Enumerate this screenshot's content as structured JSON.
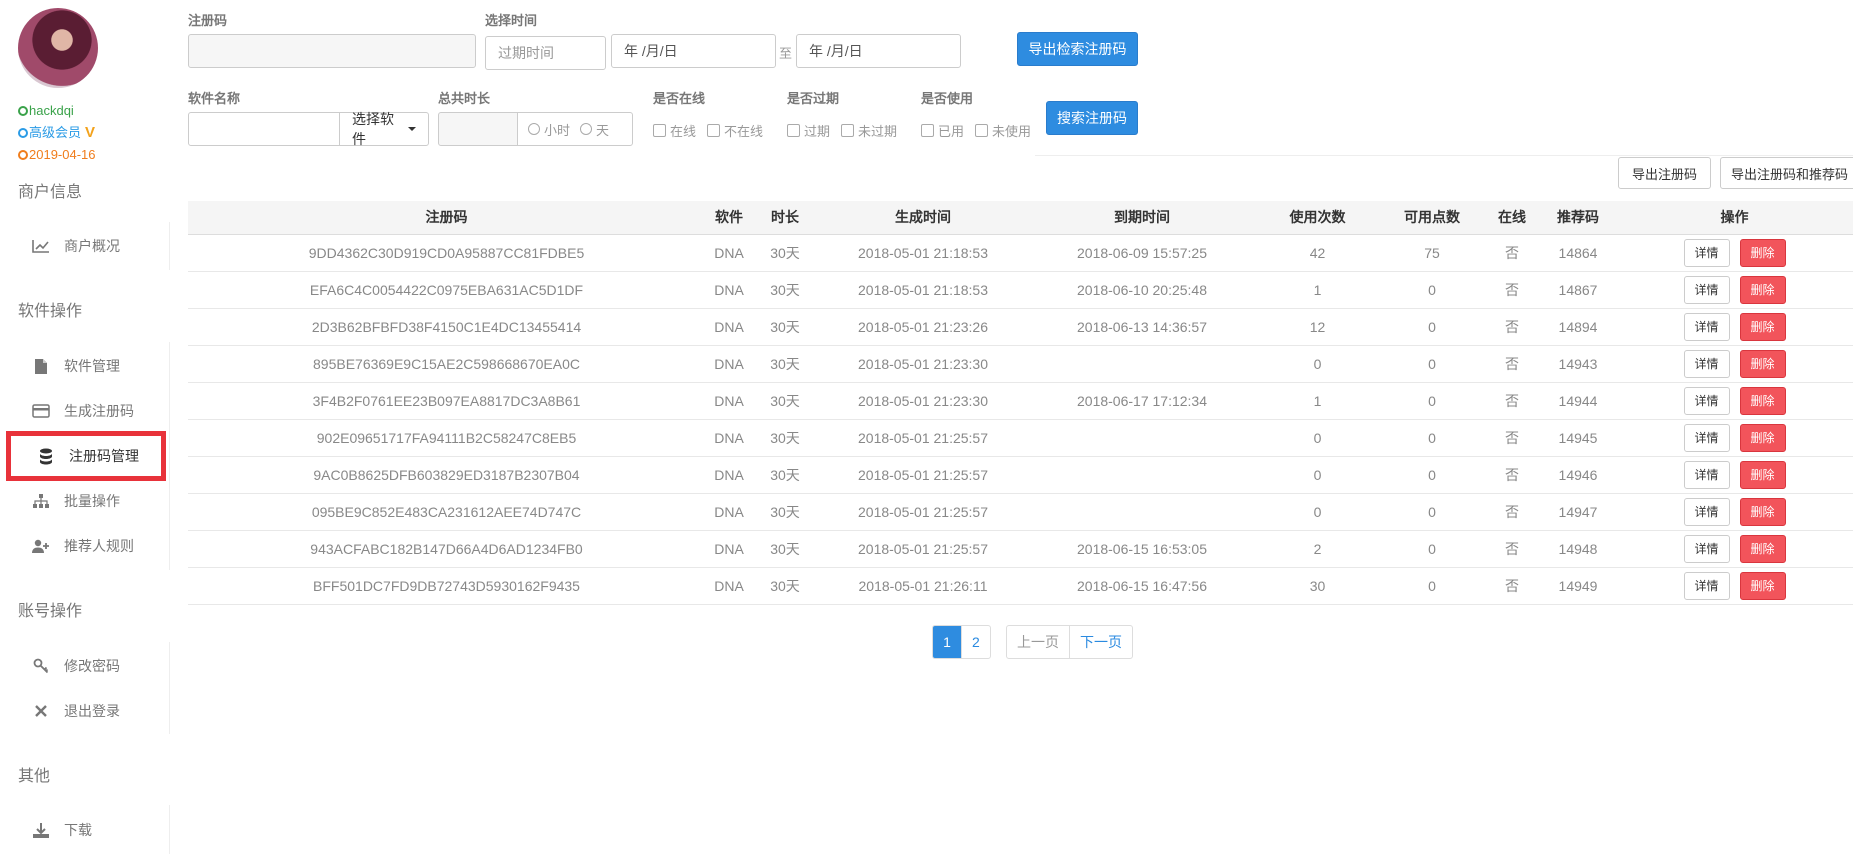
{
  "user": {
    "name": "hackdqi",
    "level": "高级会员",
    "vip_badge": "V",
    "date": "2019-04-16"
  },
  "sidebar": {
    "sections": [
      {
        "title": "商户信息",
        "items": [
          {
            "label": "商户概况",
            "icon": "chart-line-icon"
          }
        ]
      },
      {
        "title": "软件操作",
        "items": [
          {
            "label": "软件管理",
            "icon": "file-icon"
          },
          {
            "label": "生成注册码",
            "icon": "credit-card-icon"
          },
          {
            "label": "注册码管理",
            "icon": "database-icon",
            "active": true
          },
          {
            "label": "批量操作",
            "icon": "sitemap-icon"
          },
          {
            "label": "推荐人规则",
            "icon": "user-plus-icon"
          }
        ]
      },
      {
        "title": "账号操作",
        "items": [
          {
            "label": "修改密码",
            "icon": "key-icon"
          },
          {
            "label": "退出登录",
            "icon": "close-icon"
          }
        ]
      },
      {
        "title": "其他",
        "items": [
          {
            "label": "下载",
            "icon": "download-icon"
          }
        ]
      }
    ]
  },
  "filters": {
    "code_label": "注册码",
    "code_value": "",
    "time_label": "选择时间",
    "expire_placeholder": "过期时间",
    "date_from": "年 /月/日",
    "to_label": "至",
    "date_to": "年 /月/日",
    "export_search_label": "导出检索注册码",
    "software_label": "软件名称",
    "software_value": "",
    "select_software_label": "选择软件",
    "duration_label": "总共时长",
    "duration_value": "",
    "unit_hour": "小时",
    "unit_day": "天",
    "online_label": "是否在线",
    "online_yes": "在线",
    "online_no": "不在线",
    "expired_label": "是否过期",
    "expired_yes": "过期",
    "expired_no": "未过期",
    "used_label": "是否使用",
    "used_yes": "已用",
    "used_no": "未使用",
    "search_label": "搜索注册码"
  },
  "toolbar": {
    "export_label": "导出注册码",
    "export_ref_label": "导出注册码和推荐码"
  },
  "table": {
    "columns": [
      "注册码",
      "软件",
      "时长",
      "生成时间",
      "到期时间",
      "使用次数",
      "可用点数",
      "在线",
      "推荐码",
      "操作"
    ],
    "detail_label": "详情",
    "delete_label": "删除",
    "rows": [
      [
        "9DD4362C30D919CD0A95887CC81FDBE5",
        "DNA",
        "30天",
        "2018-05-01 21:18:53",
        "2018-06-09 15:57:25",
        "42",
        "75",
        "否",
        "14864"
      ],
      [
        "EFA6C4C0054422C0975EBA631AC5D1DF",
        "DNA",
        "30天",
        "2018-05-01 21:18:53",
        "2018-06-10 20:25:48",
        "1",
        "0",
        "否",
        "14867"
      ],
      [
        "2D3B62BFBFD38F4150C1E4DC13455414",
        "DNA",
        "30天",
        "2018-05-01 21:23:26",
        "2018-06-13 14:36:57",
        "12",
        "0",
        "否",
        "14894"
      ],
      [
        "895BE76369E9C15AE2C598668670EA0C",
        "DNA",
        "30天",
        "2018-05-01 21:23:30",
        "",
        "0",
        "0",
        "否",
        "14943"
      ],
      [
        "3F4B2F0761EE23B097EA8817DC3A8B61",
        "DNA",
        "30天",
        "2018-05-01 21:23:30",
        "2018-06-17 17:12:34",
        "1",
        "0",
        "否",
        "14944"
      ],
      [
        "902E09651717FA94111B2C58247C8EB5",
        "DNA",
        "30天",
        "2018-05-01 21:25:57",
        "",
        "0",
        "0",
        "否",
        "14945"
      ],
      [
        "9AC0B8625DFB603829ED3187B2307B04",
        "DNA",
        "30天",
        "2018-05-01 21:25:57",
        "",
        "0",
        "0",
        "否",
        "14946"
      ],
      [
        "095BE9C852E483CA231612AEE74D747C",
        "DNA",
        "30天",
        "2018-05-01 21:25:57",
        "",
        "0",
        "0",
        "否",
        "14947"
      ],
      [
        "943ACFABC182B147D66A4D6AD1234FB0",
        "DNA",
        "30天",
        "2018-05-01 21:25:57",
        "2018-06-15 16:53:05",
        "2",
        "0",
        "否",
        "14948"
      ],
      [
        "BFF501DC7FD9DB72743D5930162F9435",
        "DNA",
        "30天",
        "2018-05-01 21:26:11",
        "2018-06-15 16:47:56",
        "30",
        "0",
        "否",
        "14949"
      ]
    ]
  },
  "pagination": {
    "pages": [
      "1",
      "2"
    ],
    "current": "1",
    "prev_label": "上一页",
    "next_label": "下一页"
  }
}
